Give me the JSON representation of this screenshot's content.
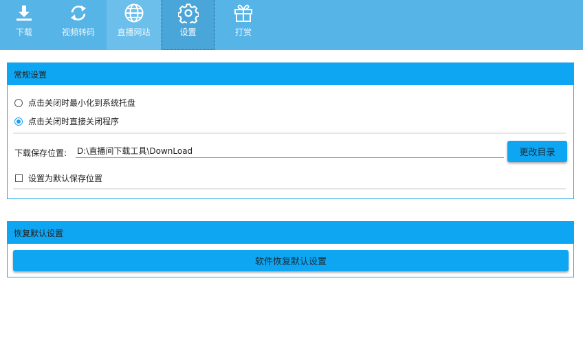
{
  "toolbar": {
    "items": [
      {
        "label": "下载",
        "icon": "download-icon"
      },
      {
        "label": "视频转码",
        "icon": "convert-icon"
      },
      {
        "label": "直播网站",
        "icon": "globe-icon"
      },
      {
        "label": "设置",
        "icon": "gear-icon",
        "active": true
      },
      {
        "label": "打赏",
        "icon": "gift-icon"
      }
    ]
  },
  "general": {
    "title": "常规设置",
    "radio_minimize": "点击关闭时最小化到系统托盘",
    "radio_exit": "点击关闭时直接关闭程序",
    "selected": "radio_exit",
    "path_label": "下载保存位置:",
    "path_value": "D:\\直播间下载工具\\DownLoad",
    "change_dir_button": "更改目录",
    "default_checkbox": "设置为默认保存位置",
    "default_checked": false
  },
  "restore": {
    "title": "恢复默认设置",
    "button": "软件恢复默认设置"
  },
  "colors": {
    "toolbar": "#56b4e6",
    "accent": "#0ea6f2",
    "active_tab": "#4aa5d8"
  }
}
